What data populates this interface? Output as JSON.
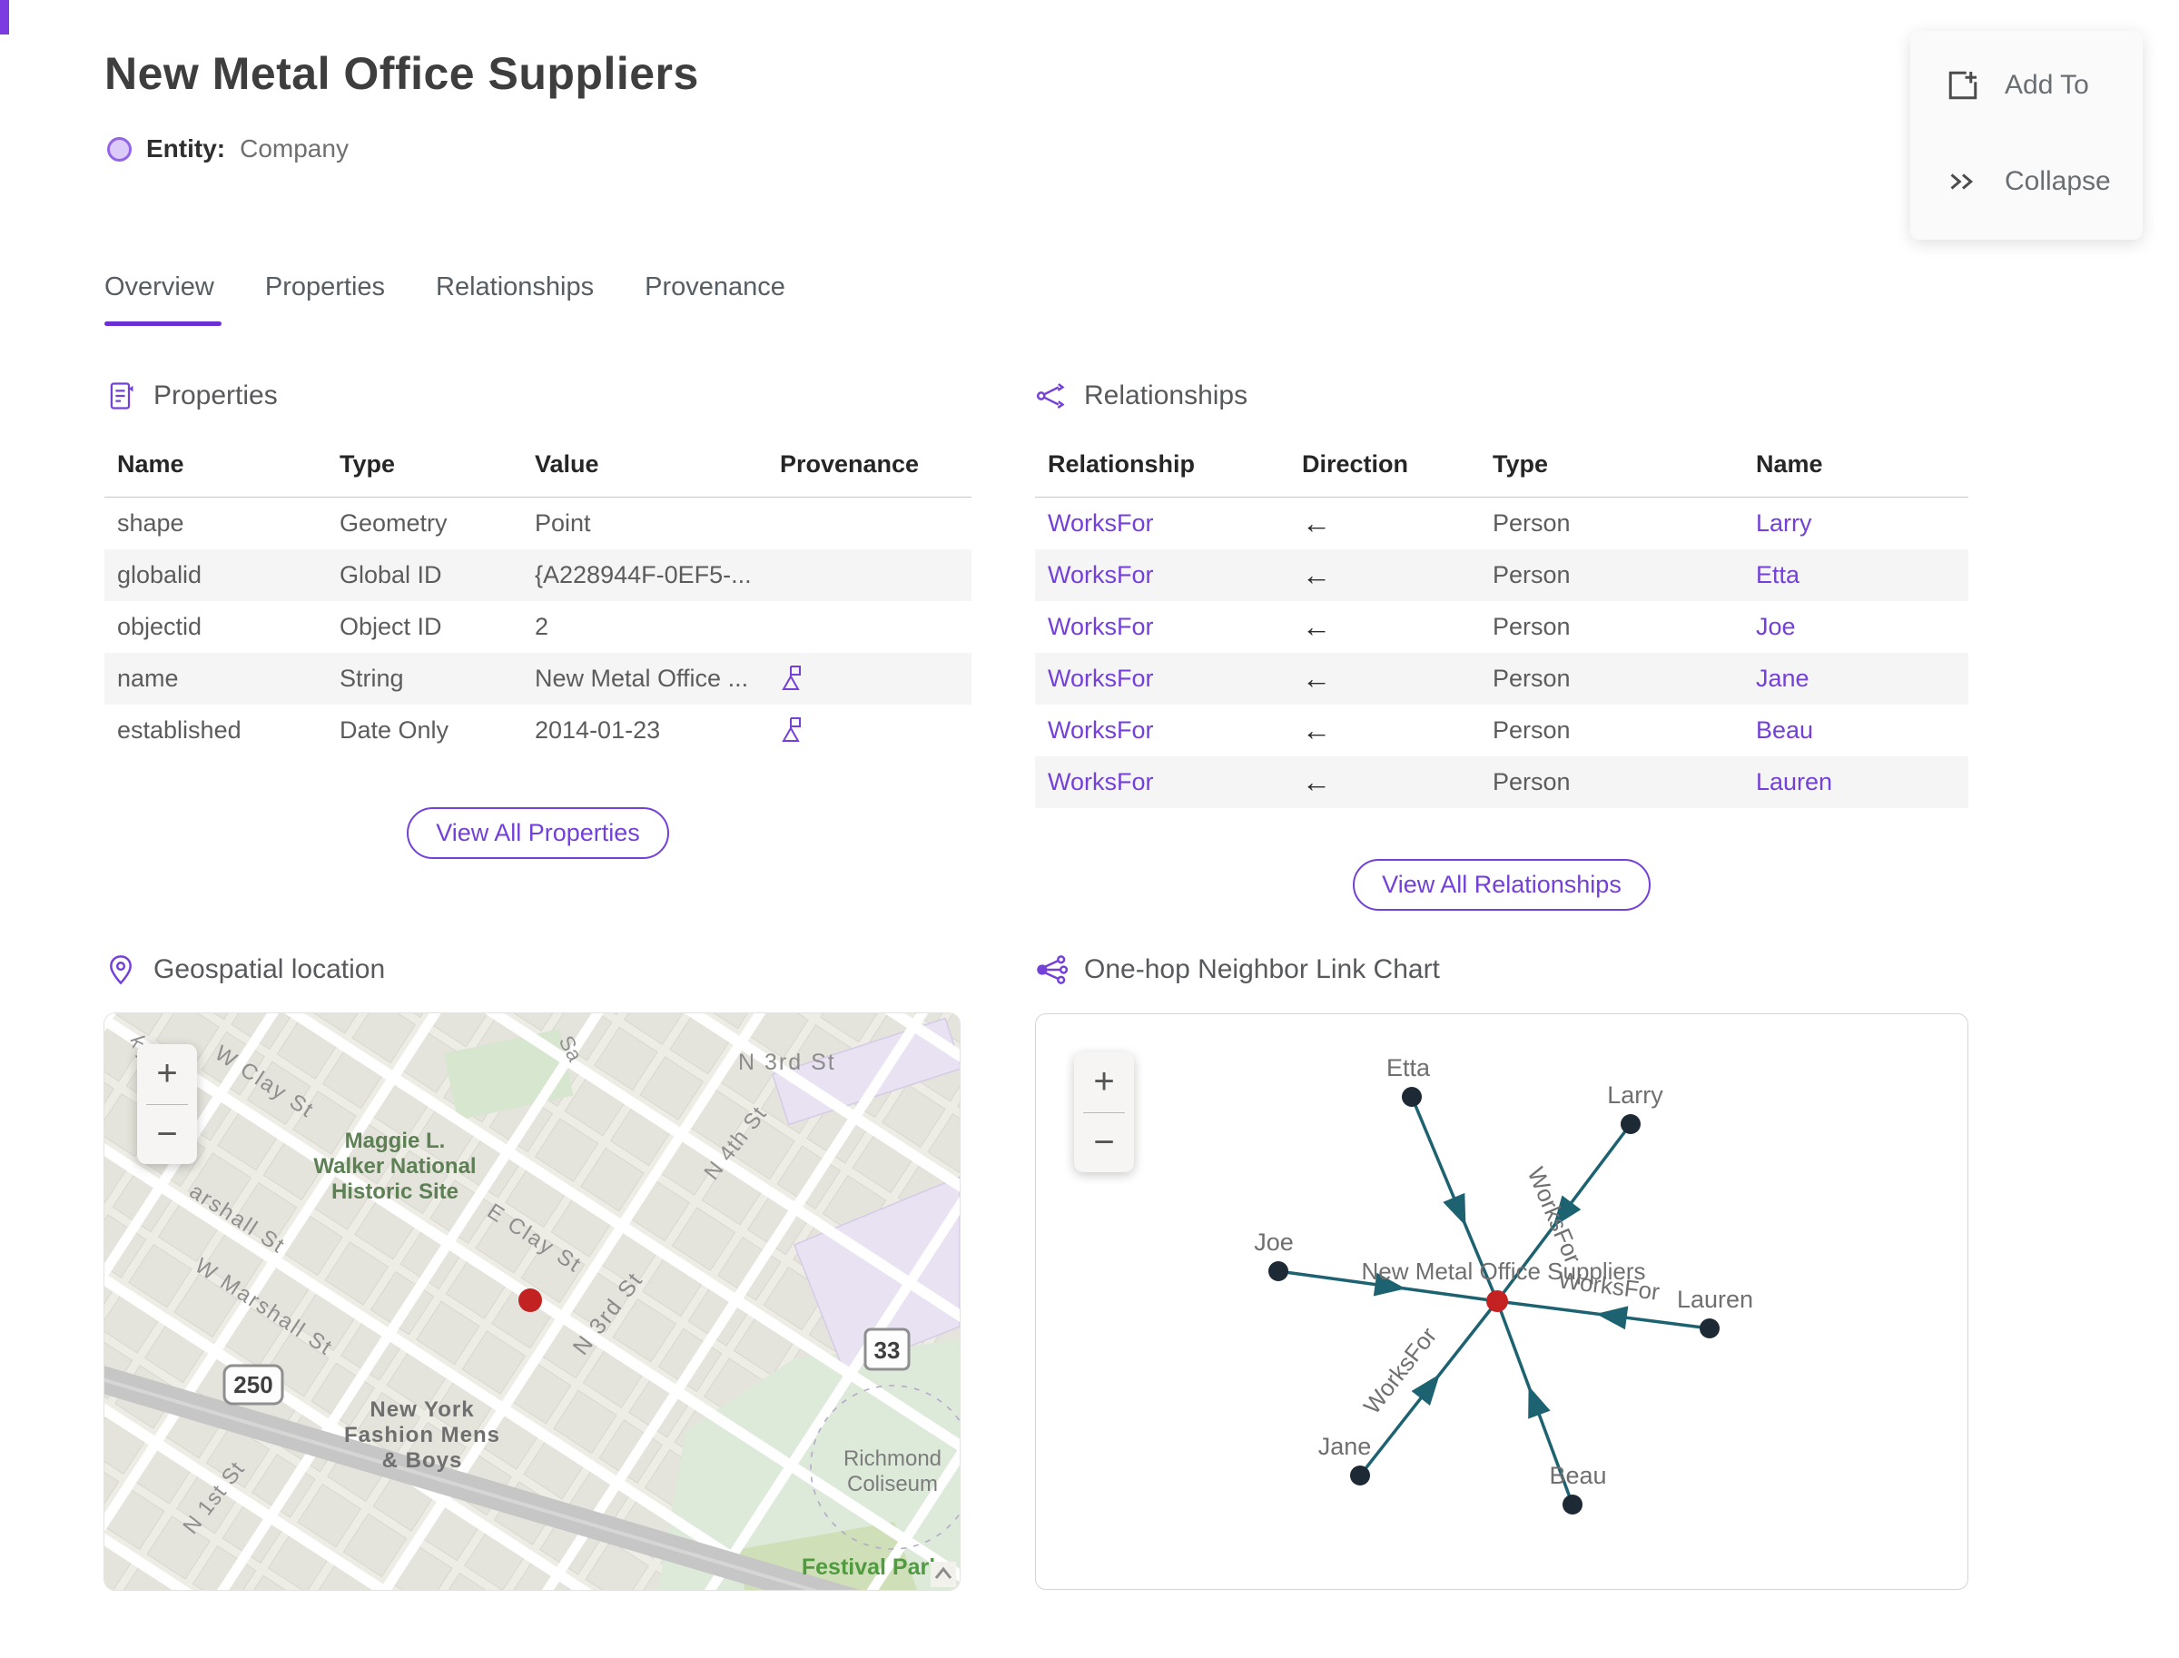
{
  "colors": {
    "accent": "#7340d9",
    "edge_teal": "#1d6270",
    "node_dark": "#1d2935",
    "center_red": "#c42222",
    "marker_red": "#c32222"
  },
  "header": {
    "title": "New Metal Office Suppliers",
    "entity_label": "Entity:",
    "entity_type": "Company"
  },
  "actions": {
    "add_to": "Add To",
    "collapse": "Collapse"
  },
  "tabs": [
    {
      "label": "Overview"
    },
    {
      "label": "Properties"
    },
    {
      "label": "Relationships"
    },
    {
      "label": "Provenance"
    }
  ],
  "properties_section": {
    "title": "Properties",
    "columns": [
      "Name",
      "Type",
      "Value",
      "Provenance"
    ],
    "rows": [
      {
        "name": "shape",
        "type": "Geometry",
        "value": "Point"
      },
      {
        "name": "globalid",
        "type": "Global ID",
        "value": "{A228944F-0EF5-..."
      },
      {
        "name": "objectid",
        "type": "Object ID",
        "value": "2"
      },
      {
        "name": "name",
        "type": "String",
        "value": "New Metal Office ..."
      },
      {
        "name": "established",
        "type": "Date Only",
        "value": "2014-01-23"
      }
    ],
    "view_all": "View All Properties"
  },
  "relationships_section": {
    "title": "Relationships",
    "columns": [
      "Relationship",
      "Direction",
      "Type",
      "Name"
    ],
    "rows": [
      {
        "relationship": "WorksFor",
        "direction": "←",
        "type": "Person",
        "name": "Larry"
      },
      {
        "relationship": "WorksFor",
        "direction": "←",
        "type": "Person",
        "name": "Etta"
      },
      {
        "relationship": "WorksFor",
        "direction": "←",
        "type": "Person",
        "name": "Joe"
      },
      {
        "relationship": "WorksFor",
        "direction": "←",
        "type": "Person",
        "name": "Jane"
      },
      {
        "relationship": "WorksFor",
        "direction": "←",
        "type": "Person",
        "name": "Beau"
      },
      {
        "relationship": "WorksFor",
        "direction": "←",
        "type": "Person",
        "name": "Lauren"
      }
    ],
    "view_all": "View All Relationships"
  },
  "map_section": {
    "title": "Geospatial location",
    "zoom_in": "+",
    "zoom_out": "−",
    "labels": {
      "k_rd": "k Rd",
      "w_clay": "W Clay St",
      "sa": "Sa",
      "n3rd_top": "N 3rd St",
      "n4th": "N 4th St",
      "maggie_1": "Maggie L.",
      "maggie_2": "Walker National",
      "maggie_3": "Historic Site",
      "e_clay": "E Clay St",
      "marshall": "arshall St",
      "w_marshall": "W Marshall St",
      "route250": "250",
      "ny_1": "New York",
      "ny_2": "Fashion Mens",
      "ny_3": "& Boys",
      "n1st": "N 1st St",
      "n3rd_diag": "N 3rd St",
      "route33": "33",
      "coliseum_1": "Richmond",
      "coliseum_2": "Coliseum",
      "festival": "Festival Park"
    }
  },
  "linkchart_section": {
    "title": "One-hop Neighbor Link Chart",
    "zoom_in": "+",
    "zoom_out": "−",
    "center_label": "New Metal Office Suppliers",
    "edge_label": "WorksFor",
    "nodes": [
      "Etta",
      "Larry",
      "Joe",
      "Lauren",
      "Jane",
      "Beau"
    ]
  }
}
